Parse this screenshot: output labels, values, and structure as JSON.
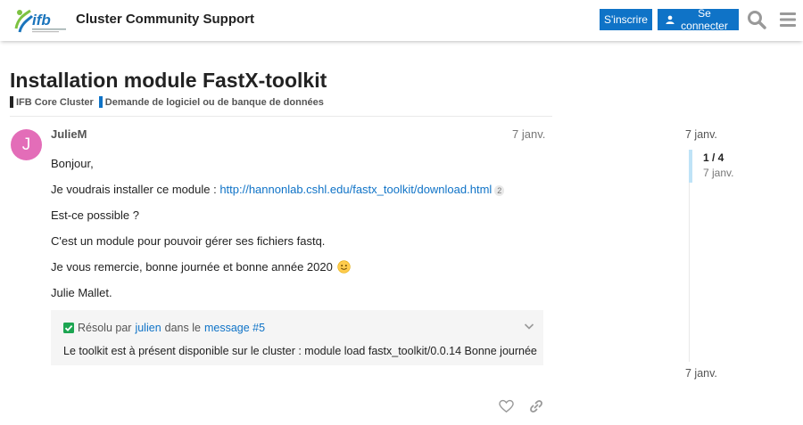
{
  "header": {
    "site_title": "Cluster Community Support",
    "logo_text": "ifb",
    "signup_label": "S'inscrire",
    "login_label": "Se connecter",
    "accent_color": "#0f73c7"
  },
  "topic": {
    "title": "Installation module FastX-toolkit",
    "categories": [
      {
        "label": "IFB Core Cluster",
        "color": "#222222"
      },
      {
        "label": "Demande de logiciel ou de banque de données",
        "color": "#0f73c7"
      }
    ]
  },
  "post": {
    "avatar_letter": "J",
    "avatar_color": "#e36db8",
    "username": "JulieM",
    "date": "7 janv.",
    "greeting": "Bonjour,",
    "line_install_prefix": "Je voudrais installer ce module : ",
    "install_link": "http://hannonlab.cshl.edu/fastx_toolkit/download.html",
    "install_link_clicks": "2",
    "question": "Est-ce possible ?",
    "explanation": "C'est un module pour pouvoir gérer ses fichiers fastq.",
    "thanks": "Je vous remercie, bonne journée et bonne année 2020",
    "signature": "Julie Mallet.",
    "emoji": "slightly-smiling-face"
  },
  "solution": {
    "resolved_prefix": "Résolu par",
    "resolved_user": "julien",
    "in_label": "dans le",
    "message_link": "message #5",
    "text": "Le toolkit est à présent disponible sur le cluster : module load fastx_toolkit/0.0.14 Bonne journée"
  },
  "timeline": {
    "top_date": "7 janv.",
    "position": "1 / 4",
    "position_date": "7 janv.",
    "bottom_date": "7 janv."
  }
}
